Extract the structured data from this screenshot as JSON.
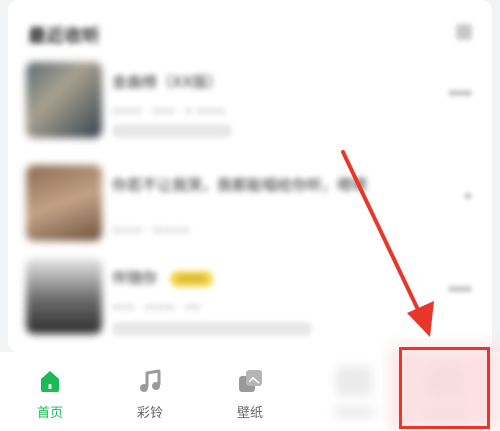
{
  "recent_section": {
    "title": "最近收听",
    "items": [
      {
        "title": "金曲榜（XX版）",
        "meta": "▫▫▫▫ · ▫▫▫ · ▫ ▫▫▫▫",
        "chip": "▫▫▫▫▫▫▫"
      },
      {
        "title": "你若不让我哭，我都能唱给你听，嗯嗯",
        "meta": "▫▫▫▫ · ▫▫▫▫▫",
        "chip": ""
      },
      {
        "title": "伴随你",
        "badge": "▫▫▫▫",
        "meta": "▫▫▫ · ▫▫▫▫ · ▫▫",
        "chip": "▫▫▫▫▫▫▫▫▫▫▫▫"
      }
    ]
  },
  "tabbar": {
    "tabs": [
      {
        "label": "首页",
        "icon": "home-icon",
        "active": true
      },
      {
        "label": "彩铃",
        "icon": "music-note-icon",
        "active": false
      },
      {
        "label": "壁纸",
        "icon": "wallpaper-icon",
        "active": false
      }
    ]
  },
  "colors": {
    "accent": "#1cb954",
    "annotation": "#e8372a"
  }
}
